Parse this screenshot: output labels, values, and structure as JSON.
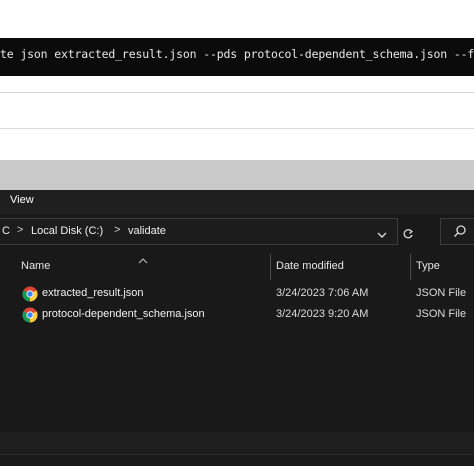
{
  "terminal": {
    "command": "te json extracted_result.json --pds protocol-dependent_schema.json --f"
  },
  "menu": {
    "view_label": "View"
  },
  "address": {
    "crumbs": [
      "C",
      "Local Disk (C:)",
      "validate"
    ],
    "separator": ">"
  },
  "columns": {
    "name": "Name",
    "date_modified": "Date modified",
    "type": "Type"
  },
  "files": [
    {
      "name": "extracted_result.json",
      "date": "3/24/2023 7:06 AM",
      "type": "JSON File",
      "icon": "chrome-icon"
    },
    {
      "name": "protocol-dependent_schema.json",
      "date": "3/24/2023 9:20 AM",
      "type": "JSON File",
      "icon": "chrome-icon"
    }
  ],
  "colors": {
    "window_bg": "#191919",
    "terminal_bg": "#0b0b0c",
    "frame": "#c9c9c9"
  }
}
